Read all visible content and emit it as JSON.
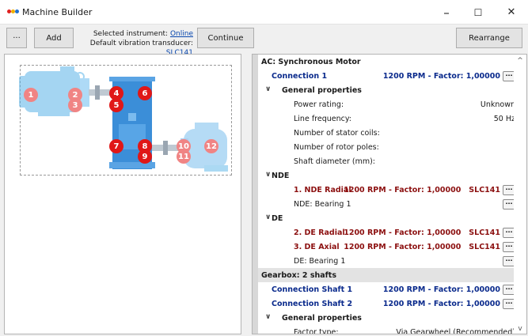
{
  "window": {
    "title": "Machine Builder",
    "minimize": "–",
    "maximize": "☐",
    "close": "✕",
    "logo_colors": [
      "#e02020",
      "#f0b000",
      "#2070d0"
    ]
  },
  "toolbar": {
    "more_label": "···",
    "add_label": "Add",
    "selected_instrument_label": "Selected instrument:",
    "selected_instrument_value": "Online",
    "default_transducer_label": "Default vibration transducer:",
    "default_transducer_value": "SLC141",
    "continue_label": "Continue",
    "rearrange_label": "Rearrange"
  },
  "diagram": {
    "markers": [
      {
        "n": "1",
        "style": "faded"
      },
      {
        "n": "2",
        "style": "faded"
      },
      {
        "n": "3",
        "style": "faded"
      },
      {
        "n": "4",
        "style": "solid"
      },
      {
        "n": "5",
        "style": "solid"
      },
      {
        "n": "6",
        "style": "solid"
      },
      {
        "n": "7",
        "style": "solid"
      },
      {
        "n": "8",
        "style": "solid"
      },
      {
        "n": "9",
        "style": "solid"
      },
      {
        "n": "10",
        "style": "faded"
      },
      {
        "n": "11",
        "style": "faded"
      },
      {
        "n": "12",
        "style": "faded"
      }
    ]
  },
  "tree": {
    "section1": "AC: Synchronous Motor",
    "connection1": {
      "label": "Connection 1",
      "value": "1200 RPM - Factor: 1,00000"
    },
    "general1": "General properties",
    "props": [
      {
        "label": "Power rating:",
        "value": "Unknown"
      },
      {
        "label": "Line frequency:",
        "value": "50 Hz"
      },
      {
        "label": "Number of stator coils:",
        "value": ""
      },
      {
        "label": "Number of rotor poles:",
        "value": ""
      },
      {
        "label": "Shaft diameter (mm):",
        "value": ""
      }
    ],
    "nde": "NDE",
    "nde_radial": {
      "label": "1. NDE Radial",
      "value": "1200 RPM - Factor: 1,00000",
      "transducer": "SLC141"
    },
    "nde_bearing": "NDE: Bearing 1",
    "de": "DE",
    "de_radial": {
      "label": "2. DE Radial",
      "value": "1200 RPM - Factor: 1,00000",
      "transducer": "SLC141"
    },
    "de_axial": {
      "label": "3. DE Axial",
      "value": "1200 RPM - Factor: 1,00000",
      "transducer": "SLC141"
    },
    "de_bearing": "DE: Bearing 1",
    "section2": "Gearbox: 2 shafts",
    "conn_shaft1": {
      "label": "Connection Shaft 1",
      "value": "1200 RPM - Factor: 1,00000"
    },
    "conn_shaft2": {
      "label": "Connection Shaft 2",
      "value": "1200 RPM - Factor: 1,00000"
    },
    "general2": "General properties",
    "factor_type": {
      "label": "Factor type:",
      "value": "Via Gearwheel (Recommended)"
    },
    "ellipsis": "···",
    "expand_glyph": "∨"
  },
  "scroll": {
    "up": "^",
    "down": "v"
  }
}
